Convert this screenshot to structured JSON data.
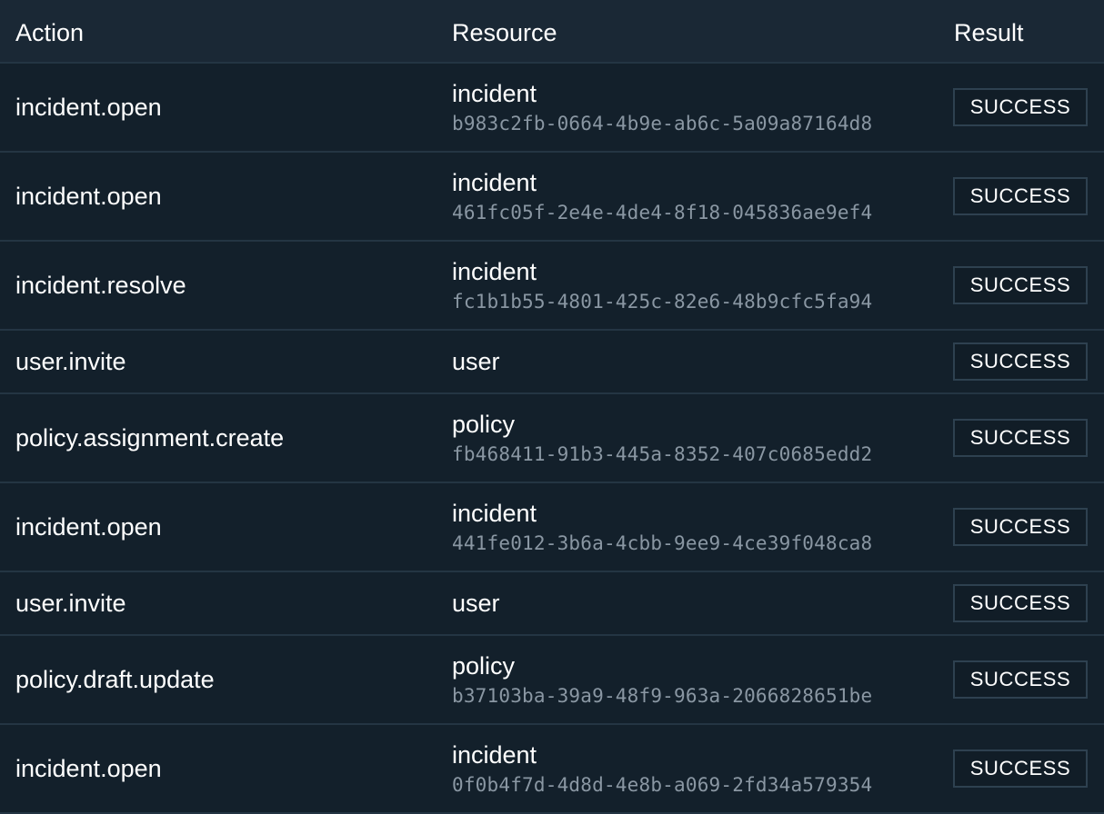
{
  "header": {
    "action": "Action",
    "resource": "Resource",
    "result": "Result"
  },
  "rows": [
    {
      "action": "incident.open",
      "resource_type": "incident",
      "resource_id": "b983c2fb-0664-4b9e-ab6c-5a09a87164d8",
      "result": "SUCCESS"
    },
    {
      "action": "incident.open",
      "resource_type": "incident",
      "resource_id": "461fc05f-2e4e-4de4-8f18-045836ae9ef4",
      "result": "SUCCESS"
    },
    {
      "action": "incident.resolve",
      "resource_type": "incident",
      "resource_id": "fc1b1b55-4801-425c-82e6-48b9cfc5fa94",
      "result": "SUCCESS"
    },
    {
      "action": "user.invite",
      "resource_type": "user",
      "resource_id": "",
      "result": "SUCCESS"
    },
    {
      "action": "policy.assignment.create",
      "resource_type": "policy",
      "resource_id": "fb468411-91b3-445a-8352-407c0685edd2",
      "result": "SUCCESS"
    },
    {
      "action": "incident.open",
      "resource_type": "incident",
      "resource_id": "441fe012-3b6a-4cbb-9ee9-4ce39f048ca8",
      "result": "SUCCESS"
    },
    {
      "action": "user.invite",
      "resource_type": "user",
      "resource_id": "",
      "result": "SUCCESS"
    },
    {
      "action": "policy.draft.update",
      "resource_type": "policy",
      "resource_id": "b37103ba-39a9-48f9-963a-2066828651be",
      "result": "SUCCESS"
    },
    {
      "action": "incident.open",
      "resource_type": "incident",
      "resource_id": "0f0b4f7d-4d8d-4e8b-a069-2fd34a579354",
      "result": "SUCCESS"
    }
  ],
  "colors": {
    "background": "#13202b",
    "header_background": "#1a2835",
    "divider": "#243543",
    "id_text": "#8a97a3",
    "badge_border": "#2e4150"
  }
}
